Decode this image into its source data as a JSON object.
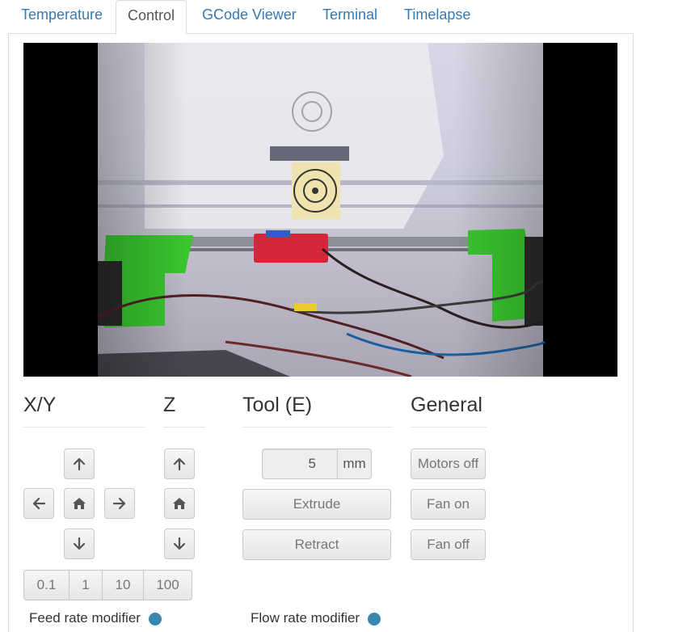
{
  "tabs": [
    {
      "label": "Temperature",
      "active": false
    },
    {
      "label": "Control",
      "active": true
    },
    {
      "label": "GCode Viewer",
      "active": false
    },
    {
      "label": "Terminal",
      "active": false
    },
    {
      "label": "Timelapse",
      "active": false
    }
  ],
  "sections": {
    "xy": {
      "title": "X/Y"
    },
    "z": {
      "title": "Z"
    },
    "tool": {
      "title": "Tool (E)"
    },
    "general": {
      "title": "General"
    }
  },
  "jog": {
    "distances": [
      "0.1",
      "1",
      "10",
      "100"
    ]
  },
  "tool": {
    "amount_value": "5",
    "amount_unit": "mm",
    "extrude_label": "Extrude",
    "retract_label": "Retract"
  },
  "general": {
    "motors_off_label": "Motors off",
    "fan_on_label": "Fan on",
    "fan_off_label": "Fan off"
  },
  "modifiers": {
    "feed_rate_label": "Feed rate modifier",
    "flow_rate_label": "Flow rate modifier"
  },
  "colors": {
    "link": "#337ab7",
    "button_text": "#777777",
    "info_icon": "#3a87ad"
  },
  "icons": {
    "up": "arrow-up-icon",
    "down": "arrow-down-icon",
    "left": "arrow-left-icon",
    "right": "arrow-right-icon",
    "home": "home-icon",
    "info": "info-icon"
  }
}
